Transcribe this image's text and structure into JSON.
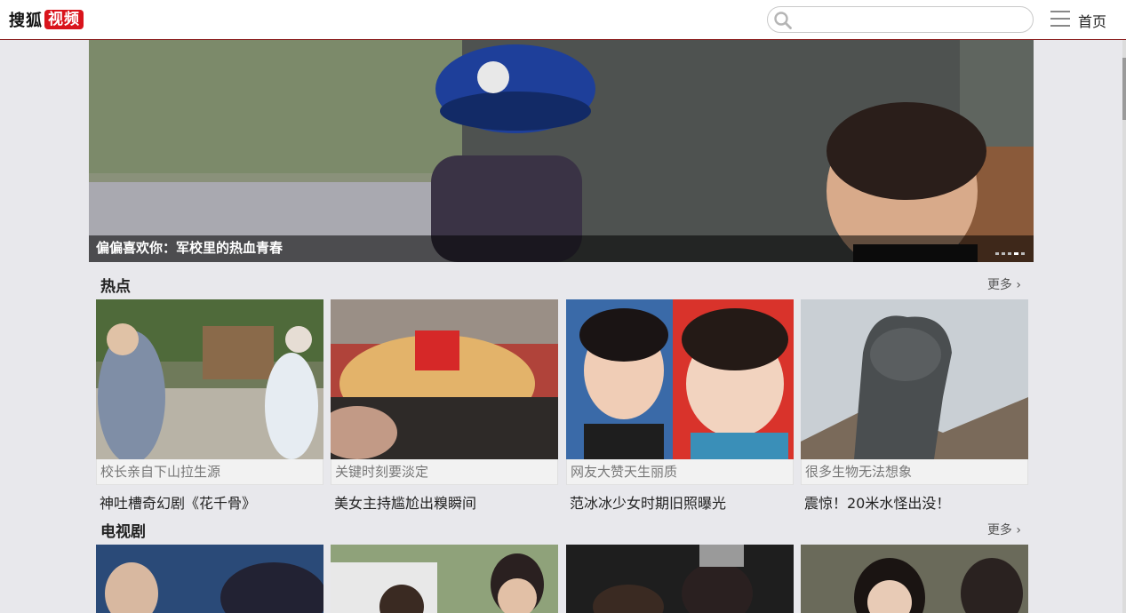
{
  "header": {
    "logo_text": "搜狐",
    "logo_badge": "视频",
    "search_placeholder": "",
    "home_label": "首页"
  },
  "banner": {
    "title": "偏偏喜欢你：军校里的热血青春",
    "slide_count": 5,
    "active_slide": 4
  },
  "sections": [
    {
      "title": "热点",
      "more": "更多 ›",
      "cards": [
        {
          "tag": "校长亲自下山拉生源",
          "title": "神吐槽奇幻剧《花千骨》"
        },
        {
          "tag": "关键时刻要淡定",
          "title": "美女主持尴尬出糗瞬间"
        },
        {
          "tag": "网友大赞天生丽质",
          "title": "范冰冰少女时期旧照曝光"
        },
        {
          "tag": "很多生物无法想象",
          "title": "震惊！20米水怪出没！"
        }
      ]
    },
    {
      "title": "电视剧",
      "more": "更多 ›",
      "cards": [
        {},
        {},
        {},
        {}
      ]
    }
  ],
  "colors": {
    "brand_red": "#d9141c",
    "header_border": "#8a1c1c",
    "page_bg": "#e8e8ec"
  }
}
